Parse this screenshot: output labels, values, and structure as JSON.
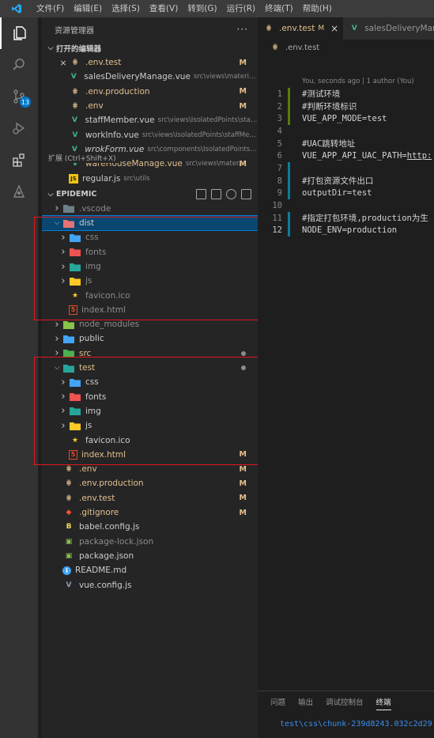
{
  "menu": [
    "文件(F)",
    "编辑(E)",
    "选择(S)",
    "查看(V)",
    "转到(G)",
    "运行(R)",
    "终端(T)",
    "帮助(H)"
  ],
  "activity": {
    "scm_badge": "13"
  },
  "sidebar": {
    "title": "资源管理器",
    "more": "···",
    "open_editors_title": "打开的编辑器",
    "open_editors": [
      {
        "name": ".env.test",
        "path": "",
        "badge": "M",
        "icon": "env",
        "close": true
      },
      {
        "name": "salesDeliveryManage.vue",
        "path": "src\\views\\materialM...",
        "badge": "",
        "icon": "vue"
      },
      {
        "name": ".env.production",
        "path": "",
        "badge": "M",
        "icon": "env"
      },
      {
        "name": ".env",
        "path": "",
        "badge": "M",
        "icon": "env"
      },
      {
        "name": "staffMember.vue",
        "path": "src\\views\\IsolatedPoints\\staff...",
        "badge": "",
        "icon": "vue"
      },
      {
        "name": "workInfo.vue",
        "path": "src\\views\\IsolatedPoints\\staffMe...",
        "badge": "",
        "icon": "vue"
      },
      {
        "name": "wrokForm.vue",
        "path": "src\\components\\IsolatedPoints\\w...",
        "badge": "",
        "icon": "vue"
      },
      {
        "name": "wareHouseManage.vue",
        "path": "src\\views\\mater...",
        "badge": "M",
        "icon": "vue"
      },
      {
        "name": "regular.js",
        "path": "src\\utils",
        "badge": "",
        "icon": "js"
      }
    ],
    "tooltip": "扩展 (Ctrl+Shift+X)",
    "project_title": "EPIDEMIC",
    "tree": [
      {
        "name": ".vscode",
        "depth": 1,
        "type": "folder",
        "color": "#6d8086",
        "chev": "right",
        "style": "ign"
      },
      {
        "name": "dist",
        "depth": 1,
        "type": "folder",
        "color": "#e57373",
        "chev": "down",
        "selected": true
      },
      {
        "name": "css",
        "depth": 2,
        "type": "folder",
        "color": "#42a5f5",
        "chev": "right",
        "style": "ign"
      },
      {
        "name": "fonts",
        "depth": 2,
        "type": "folder",
        "color": "#ef5350",
        "chev": "right",
        "style": "ign"
      },
      {
        "name": "img",
        "depth": 2,
        "type": "folder",
        "color": "#26a69a",
        "chev": "right",
        "style": "ign"
      },
      {
        "name": "js",
        "depth": 2,
        "type": "folder",
        "color": "#ffca28",
        "chev": "right",
        "style": "ign"
      },
      {
        "name": "favicon.ico",
        "depth": 2,
        "type": "star",
        "style": "ign"
      },
      {
        "name": "index.html",
        "depth": 2,
        "type": "html",
        "style": "ign"
      },
      {
        "name": "node_modules",
        "depth": 1,
        "type": "folder",
        "color": "#8bc34a",
        "chev": "right",
        "style": "ign"
      },
      {
        "name": "public",
        "depth": 1,
        "type": "folder",
        "color": "#42a5f5",
        "chev": "right"
      },
      {
        "name": "src",
        "depth": 1,
        "type": "folder",
        "color": "#4caf50",
        "chev": "right",
        "style": "mod",
        "dot": true
      },
      {
        "name": "test",
        "depth": 1,
        "type": "folder",
        "color": "#26a69a",
        "chev": "down",
        "style": "mod",
        "dot": true
      },
      {
        "name": "css",
        "depth": 2,
        "type": "folder",
        "color": "#42a5f5",
        "chev": "right"
      },
      {
        "name": "fonts",
        "depth": 2,
        "type": "folder",
        "color": "#ef5350",
        "chev": "right"
      },
      {
        "name": "img",
        "depth": 2,
        "type": "folder",
        "color": "#26a69a",
        "chev": "right"
      },
      {
        "name": "js",
        "depth": 2,
        "type": "folder",
        "color": "#ffca28",
        "chev": "right"
      },
      {
        "name": "favicon.ico",
        "depth": 2,
        "type": "star"
      },
      {
        "name": "index.html",
        "depth": 2,
        "type": "html",
        "style": "mod",
        "badge": "M"
      },
      {
        "name": ".env",
        "depth": 1,
        "type": "env",
        "style": "mod",
        "badge": "M"
      },
      {
        "name": ".env.production",
        "depth": 1,
        "type": "env",
        "style": "mod",
        "badge": "M"
      },
      {
        "name": ".env.test",
        "depth": 1,
        "type": "env",
        "style": "mod",
        "badge": "M"
      },
      {
        "name": ".gitignore",
        "depth": 1,
        "type": "git",
        "style": "mod",
        "badge": "M"
      },
      {
        "name": "babel.config.js",
        "depth": 1,
        "type": "babel"
      },
      {
        "name": "package-lock.json",
        "depth": 1,
        "type": "pkg",
        "style": "ign"
      },
      {
        "name": "package.json",
        "depth": 1,
        "type": "pkg"
      },
      {
        "name": "README.md",
        "depth": 1,
        "type": "info"
      },
      {
        "name": "vue.config.js",
        "depth": 1,
        "type": "vuecfg"
      }
    ]
  },
  "editor": {
    "tabs": [
      {
        "label": ".env.test",
        "badge": "M",
        "active": true,
        "close": "×"
      },
      {
        "label": "salesDeliveryManag",
        "active": false
      }
    ],
    "breadcrumb": ".env.test",
    "blame": "You, seconds ago | 1 author (You)",
    "lines": [
      {
        "n": "1",
        "text": "#测试环境",
        "gutter": "green"
      },
      {
        "n": "2",
        "text": "#判断环境标识",
        "gutter": "green"
      },
      {
        "n": "3",
        "text": "VUE_APP_MODE=test",
        "gutter": "green"
      },
      {
        "n": "4",
        "text": "",
        "gutter": ""
      },
      {
        "n": "5",
        "text": "#UAC跳转地址",
        "gutter": ""
      },
      {
        "n": "6",
        "text": "VUE_APP_API_UAC_PATH=",
        "link": "http:",
        "gutter": ""
      },
      {
        "n": "7",
        "text": "",
        "gutter": "blue"
      },
      {
        "n": "8",
        "text": "#打包资源文件出口",
        "gutter": "blue"
      },
      {
        "n": "9",
        "text": "outputDir=test",
        "gutter": "blue"
      },
      {
        "n": "10",
        "text": "",
        "gutter": ""
      },
      {
        "n": "11",
        "text": "#指定打包环境,production为生",
        "gutter": "blue"
      },
      {
        "n": "12",
        "text": "NODE_ENV=production",
        "gutter": "blue",
        "current": true
      }
    ]
  },
  "panel": {
    "tabs": [
      "问题",
      "输出",
      "调试控制台",
      "终端"
    ],
    "active": "终端",
    "terminal_line": "test\\css\\chunk-239d8243.032c2d29."
  },
  "colors": {
    "modified": "#e2c08d",
    "accent": "#007acc",
    "redbox": "#e0171f"
  }
}
